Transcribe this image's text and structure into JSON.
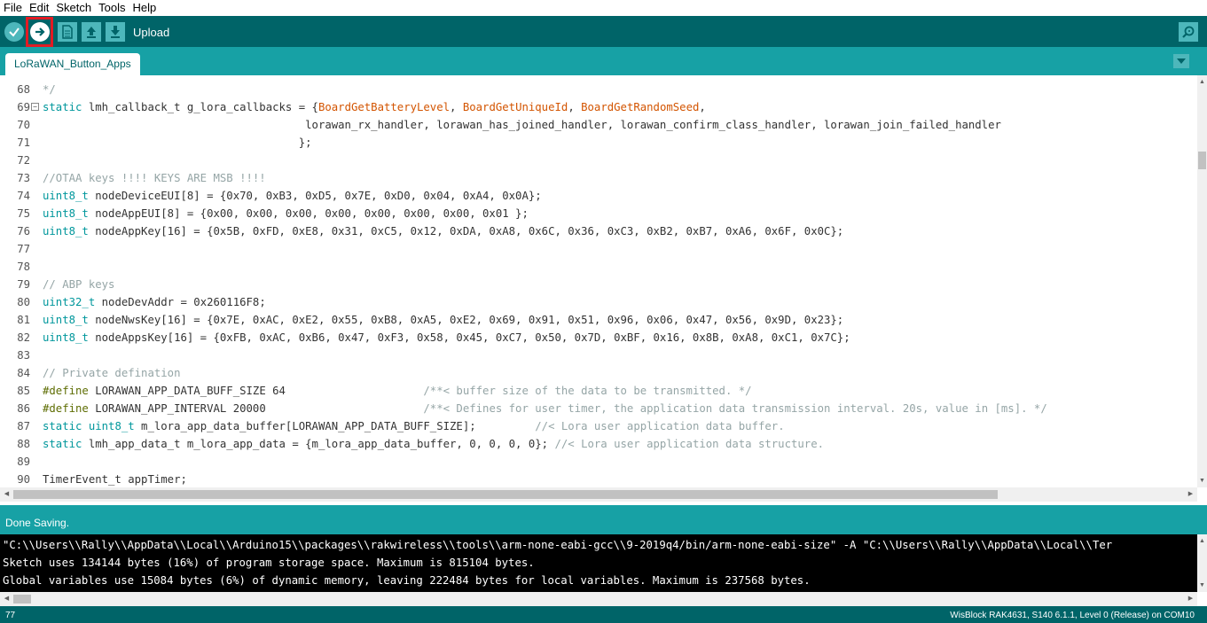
{
  "menu": [
    "File",
    "Edit",
    "Sketch",
    "Tools",
    "Help"
  ],
  "toolbar": {
    "hover_label": "Upload"
  },
  "tab": {
    "label": "LoRaWAN_Button_Apps"
  },
  "code": [
    {
      "n": "68",
      "parts": [
        [
          "cm",
          "*/"
        ]
      ]
    },
    {
      "n": "69",
      "fold": true,
      "parts": [
        [
          "kw",
          "static"
        ],
        [
          "",
          " lmh_callback_t g_lora_callbacks = {"
        ],
        [
          "fn",
          "BoardGetBatteryLevel"
        ],
        [
          "",
          ", "
        ],
        [
          "fn",
          "BoardGetUniqueId"
        ],
        [
          "",
          ", "
        ],
        [
          "fn",
          "BoardGetRandomSeed"
        ],
        [
          "",
          ","
        ]
      ]
    },
    {
      "n": "70",
      "parts": [
        [
          "",
          "                                        lorawan_rx_handler, lorawan_has_joined_handler, lorawan_confirm_class_handler, lorawan_join_failed_handler"
        ]
      ]
    },
    {
      "n": "71",
      "parts": [
        [
          "",
          "                                       };"
        ]
      ]
    },
    {
      "n": "72",
      "parts": [
        [
          "",
          ""
        ]
      ]
    },
    {
      "n": "73",
      "parts": [
        [
          "cm",
          "//OTAA keys !!!! KEYS ARE MSB !!!!"
        ]
      ]
    },
    {
      "n": "74",
      "parts": [
        [
          "kw",
          "uint8_t"
        ],
        [
          "",
          " nodeDeviceEUI[8] = {0x70, 0xB3, 0xD5, 0x7E, 0xD0, 0x04, 0xA4, 0x0A};"
        ]
      ]
    },
    {
      "n": "75",
      "parts": [
        [
          "kw",
          "uint8_t"
        ],
        [
          "",
          " nodeAppEUI[8] = {0x00, 0x00, 0x00, 0x00, 0x00, 0x00, 0x00, 0x01 };"
        ]
      ]
    },
    {
      "n": "76",
      "parts": [
        [
          "kw",
          "uint8_t"
        ],
        [
          "",
          " nodeAppKey[16] = {0x5B, 0xFD, 0xE8, 0x31, 0xC5, 0x12, 0xDA, 0xA8, 0x6C, 0x36, 0xC3, 0xB2, 0xB7, 0xA6, 0x6F, 0x0C};"
        ]
      ]
    },
    {
      "n": "77",
      "parts": [
        [
          "",
          ""
        ]
      ]
    },
    {
      "n": "78",
      "parts": [
        [
          "",
          ""
        ]
      ]
    },
    {
      "n": "79",
      "parts": [
        [
          "cm",
          "// ABP keys"
        ]
      ]
    },
    {
      "n": "80",
      "parts": [
        [
          "kw",
          "uint32_t"
        ],
        [
          "",
          " nodeDevAddr = 0x260116F8;"
        ]
      ]
    },
    {
      "n": "81",
      "parts": [
        [
          "kw",
          "uint8_t"
        ],
        [
          "",
          " nodeNwsKey[16] = {0x7E, 0xAC, 0xE2, 0x55, 0xB8, 0xA5, 0xE2, 0x69, 0x91, 0x51, 0x96, 0x06, 0x47, 0x56, 0x9D, 0x23};"
        ]
      ]
    },
    {
      "n": "82",
      "parts": [
        [
          "kw",
          "uint8_t"
        ],
        [
          "",
          " nodeAppsKey[16] = {0xFB, 0xAC, 0xB6, 0x47, 0xF3, 0x58, 0x45, 0xC7, 0x50, 0x7D, 0xBF, 0x16, 0x8B, 0xA8, 0xC1, 0x7C};"
        ]
      ]
    },
    {
      "n": "83",
      "parts": [
        [
          "",
          ""
        ]
      ]
    },
    {
      "n": "84",
      "parts": [
        [
          "cm",
          "// Private defination"
        ]
      ]
    },
    {
      "n": "85",
      "parts": [
        [
          "pp",
          "#define"
        ],
        [
          "",
          " LORAWAN_APP_DATA_BUFF_SIZE 64                     "
        ],
        [
          "cm",
          "/**< buffer size of the data to be transmitted. */"
        ]
      ]
    },
    {
      "n": "86",
      "parts": [
        [
          "pp",
          "#define"
        ],
        [
          "",
          " LORAWAN_APP_INTERVAL 20000                        "
        ],
        [
          "cm",
          "/**< Defines for user timer, the application data transmission interval. 20s, value in [ms]. */"
        ]
      ]
    },
    {
      "n": "87",
      "parts": [
        [
          "kw",
          "static"
        ],
        [
          "",
          " "
        ],
        [
          "kw",
          "uint8_t"
        ],
        [
          "",
          " m_lora_app_data_buffer[LORAWAN_APP_DATA_BUFF_SIZE];         "
        ],
        [
          "cm",
          "//< Lora user application data buffer."
        ]
      ]
    },
    {
      "n": "88",
      "parts": [
        [
          "kw",
          "static"
        ],
        [
          "",
          " lmh_app_data_t m_lora_app_data = {m_lora_app_data_buffer, 0, 0, 0, 0}; "
        ],
        [
          "cm",
          "//< Lora user application data structure."
        ]
      ]
    },
    {
      "n": "89",
      "parts": [
        [
          "",
          ""
        ]
      ]
    },
    {
      "n": "90",
      "parts": [
        [
          "",
          "TimerEvent_t appTimer;"
        ]
      ]
    }
  ],
  "status": {
    "message": "Done Saving."
  },
  "console": [
    "\"C:\\\\Users\\\\Rally\\\\AppData\\\\Local\\\\Arduino15\\\\packages\\\\rakwireless\\\\tools\\\\arm-none-eabi-gcc\\\\9-2019q4/bin/arm-none-eabi-size\" -A \"C:\\\\Users\\\\Rally\\\\AppData\\\\Local\\\\Ter",
    "Sketch uses 134144 bytes (16%) of program storage space. Maximum is 815104 bytes.",
    "Global variables use 15084 bytes (6%) of dynamic memory, leaving 222484 bytes for local variables. Maximum is 237568 bytes."
  ],
  "bottom": {
    "line": "77",
    "board": "WisBlock RAK4631, S140 6.1.1, Level 0 (Release) on COM10"
  },
  "colors": {
    "toolbar": "#006468",
    "tabbar": "#17a1a5",
    "button": "#4db7bb",
    "highlight": "#e31b23"
  },
  "icons": [
    "verify-check-icon",
    "upload-arrow-icon",
    "new-file-icon",
    "open-arrow-up-icon",
    "save-arrow-down-icon",
    "serial-monitor-magnifier-icon",
    "tab-menu-triangle-icon"
  ]
}
